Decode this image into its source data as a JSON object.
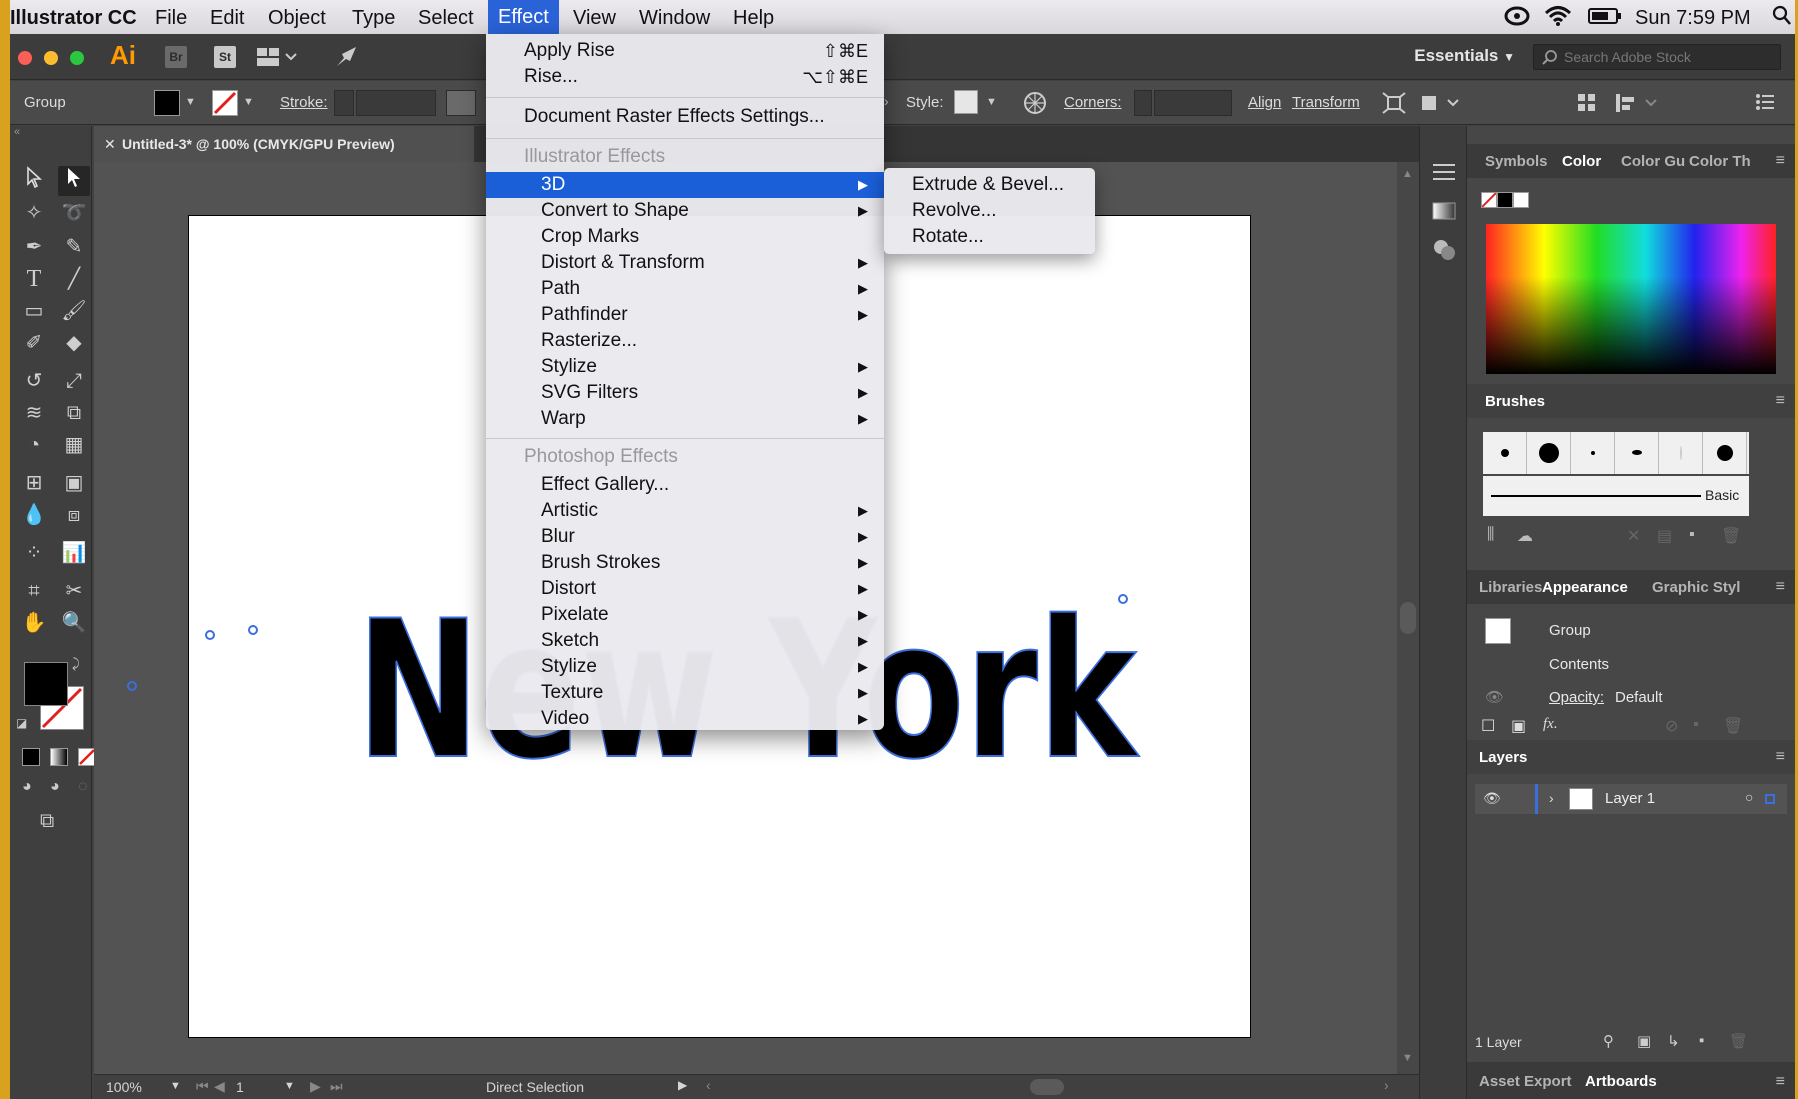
{
  "menubar": {
    "app_name": "Illustrator CC",
    "items": [
      "File",
      "Edit",
      "Object",
      "Type",
      "Select",
      "Effect",
      "View",
      "Window",
      "Help"
    ],
    "active": "Effect",
    "clock": "Sun 7:59 PM"
  },
  "appbar": {
    "logo": "Ai",
    "bridge": "Br",
    "stock": "St",
    "workspace": "Essentials",
    "search_placeholder": "Search Adobe Stock"
  },
  "control": {
    "selection_label": "Group",
    "stroke_label": "Stroke:",
    "style_label": "Style:",
    "corners_label": "Corners:",
    "align_label": "Align",
    "transform_label": "Transform"
  },
  "document": {
    "tab_title": "Untitled-3* @ 100% (CMYK/GPU Preview)",
    "zoom": "100%",
    "artboard_number": "1",
    "status_tool": "Direct Selection"
  },
  "effect_menu": {
    "apply_label": "Apply Rise",
    "apply_shortcut": "⇧⌘E",
    "last_label": "Rise...",
    "last_shortcut": "⌥⇧⌘E",
    "doc_raster": "Document Raster Effects Settings...",
    "illustrator_header": "Illustrator Effects",
    "illustrator_items": [
      "3D",
      "Convert to Shape",
      "Crop Marks",
      "Distort & Transform",
      "Path",
      "Pathfinder",
      "Rasterize...",
      "Stylize",
      "SVG Filters",
      "Warp"
    ],
    "photoshop_header": "Photoshop Effects",
    "photoshop_items": [
      "Effect Gallery...",
      "Artistic",
      "Blur",
      "Brush Strokes",
      "Distort",
      "Pixelate",
      "Sketch",
      "Stylize",
      "Texture",
      "Video"
    ]
  },
  "submenu_3d": [
    "Extrude & Bevel...",
    "Revolve...",
    "Rotate..."
  ],
  "artwork_text": "New York",
  "panels": {
    "color_tabs": [
      "Symbols",
      "Color",
      "Color Gu",
      "Color Th"
    ],
    "brushes_title": "Brushes",
    "brush_basic": "Basic",
    "appearance_tabs": [
      "Libraries",
      "Appearance",
      "Graphic Styl"
    ],
    "appearance_rows": [
      "Group",
      "Contents",
      "Opacity:",
      "Default"
    ],
    "layers_title": "Layers",
    "layer_name": "Layer 1",
    "layer_count": "1 Layer",
    "bottom_tabs": [
      "Asset Export",
      "Artboards"
    ]
  },
  "colors": {
    "accent": "#1a5fd8",
    "ai_orange": "#ff9a00",
    "selection_blue": "#3b6fe0"
  }
}
